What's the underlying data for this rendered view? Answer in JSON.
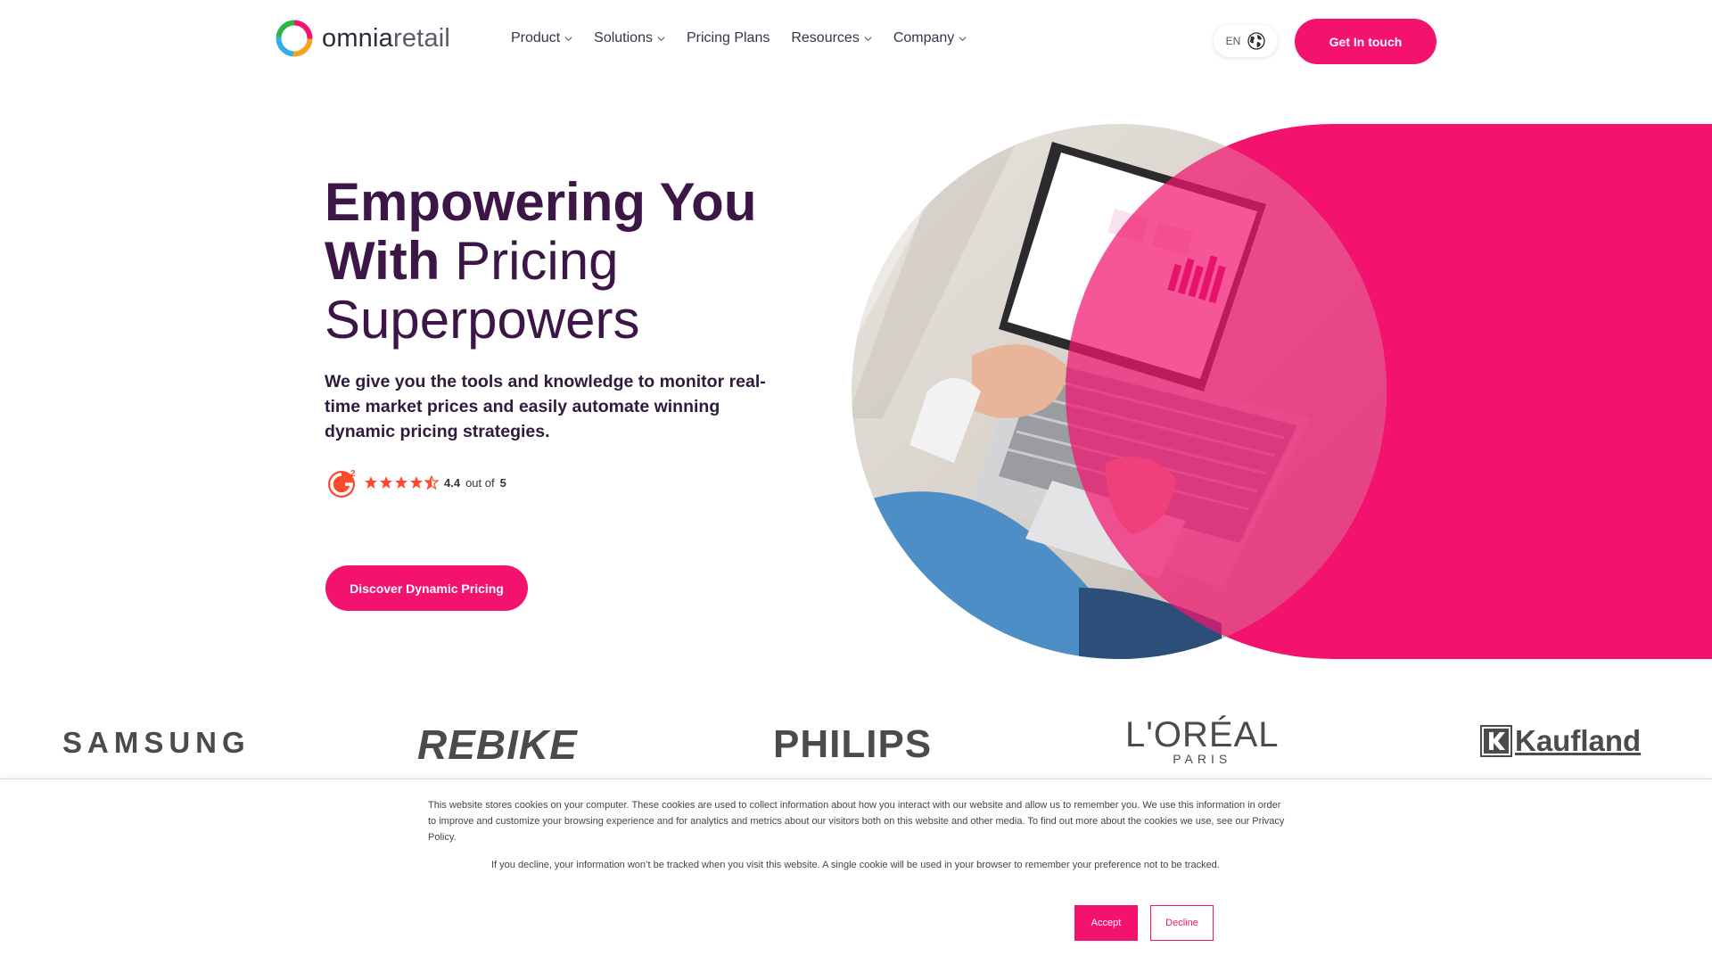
{
  "brand": {
    "name_strong": "omnia",
    "name_light": "retail"
  },
  "nav": {
    "items": [
      {
        "label": "Product",
        "dropdown": true
      },
      {
        "label": "Solutions",
        "dropdown": true
      },
      {
        "label": "Pricing Plans",
        "dropdown": false
      },
      {
        "label": "Resources",
        "dropdown": true
      },
      {
        "label": "Company",
        "dropdown": true
      }
    ],
    "language": "EN",
    "cta": "Get In touch"
  },
  "hero": {
    "title_bold_1": "Empowering You",
    "title_bold_2": "With",
    "title_light_2": "Pricing",
    "title_light_3": "Superpowers",
    "subtitle": "We give you the tools and knowledge to monitor real-time market prices and easily automate winning dynamic pricing strategies.",
    "rating_value": "4.4",
    "rating_out_of": "out of",
    "rating_max": "5",
    "rating_stars": 4.4,
    "cta": "Discover Dynamic Pricing"
  },
  "brands": {
    "samsung": "SAMSUNG",
    "rebike": "REBIKE",
    "philips": "PHILIPS",
    "loreal": "L'ORÉAL",
    "loreal_sub": "PARIS",
    "kaufland": "Kaufland"
  },
  "cookie": {
    "text1": "This website stores cookies on your computer. These cookies are used to collect information about how you interact with our website and allow us to remember you. We use this information in order to improve and customize your browsing experience and for analytics and metrics about our visitors both on this website and other media. To find out more about the cookies we use, see our Privacy Policy.",
    "text2": "If you decline, your information won’t be tracked when you visit this website. A single cookie will be used in your browser to remember your preference not to be tracked.",
    "accept": "Accept",
    "decline": "Decline"
  },
  "colors": {
    "accent": "#f3136f",
    "heading": "#3b1646"
  }
}
